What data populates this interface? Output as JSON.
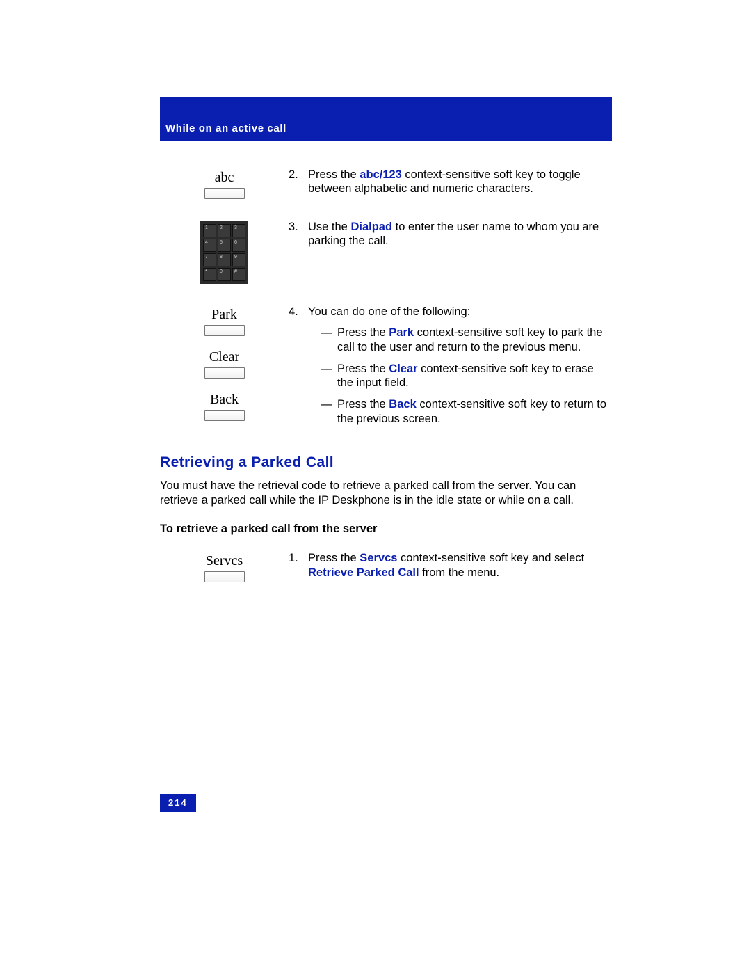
{
  "header": {
    "title": "While on an active call"
  },
  "softkeys": {
    "abc": "abc",
    "park": "Park",
    "clear": "Clear",
    "back": "Back",
    "servcs": "Servcs"
  },
  "steps": {
    "s2": {
      "num": "2.",
      "pre": "Press the ",
      "kw": "abc/123",
      "post": " context-sensitive soft key to toggle between alphabetic and numeric characters."
    },
    "s3": {
      "num": "3.",
      "pre": "Use the ",
      "kw": "Dialpad",
      "post": " to enter the user name to whom you are parking the call."
    },
    "s4": {
      "num": "4.",
      "intro": "You can do one of the following:",
      "a": {
        "dash": "—",
        "pre": "Press the ",
        "kw": "Park",
        "post": " context-sensitive soft key to park the call to the user and return to the previous menu."
      },
      "b": {
        "dash": "—",
        "pre": "Press the ",
        "kw": "Clear",
        "post": " context-sensitive soft key to erase the input field."
      },
      "c": {
        "dash": "—",
        "pre": "Press the ",
        "kw": "Back",
        "post": " context-sensitive soft key to return to the previous screen."
      }
    }
  },
  "section": {
    "title": "Retrieving a Parked Call",
    "para": "You must have the retrieval code to retrieve a parked call from the server. You can retrieve a parked call while the IP Deskphone is in the idle state or while on a call.",
    "subhead": "To retrieve a parked call from the server",
    "step1": {
      "num": "1.",
      "pre": "Press the ",
      "kw1": "Servcs",
      "mid": " context-sensitive soft key and select ",
      "kw2": "Retrieve Parked Call",
      "post": " from the menu."
    }
  },
  "footer": {
    "page": "214"
  }
}
